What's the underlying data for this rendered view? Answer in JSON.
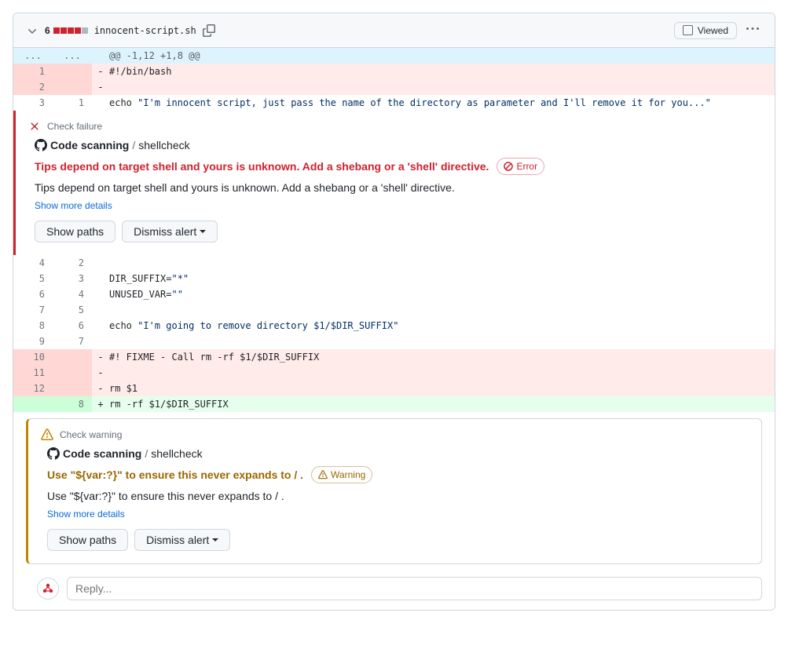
{
  "file_header": {
    "change_count": "6",
    "file_name": "innocent-script.sh",
    "viewed_label": "Viewed"
  },
  "hunk_header": "@@ -1,12 +1,8 @@",
  "lines": [
    {
      "old": "1",
      "new": "",
      "type": "del",
      "marker": "-",
      "code_html": "#!/bin/bash"
    },
    {
      "old": "2",
      "new": "",
      "type": "del",
      "marker": "-",
      "code_html": ""
    },
    {
      "old": "3",
      "new": "1",
      "type": "ctx",
      "marker": "",
      "code_html": "echo <span class=\"str\">\"I'm innocent script, just pass the name of the directory as parameter and I'll remove it for you...\"</span>"
    }
  ],
  "annotation1": {
    "label": "Check failure",
    "source_strong": "Code scanning",
    "source_rest": "shellcheck",
    "title": "Tips depend on target shell and yours is unknown. Add a shebang or a 'shell' directive.",
    "pill": "Error",
    "desc": "Tips depend on target shell and yours is unknown. Add a shebang or a 'shell' directive.",
    "details_link": "Show more details",
    "btn_paths": "Show paths",
    "btn_dismiss": "Dismiss alert"
  },
  "lines2": [
    {
      "old": "4",
      "new": "2",
      "type": "ctx",
      "marker": "",
      "code_html": ""
    },
    {
      "old": "5",
      "new": "3",
      "type": "ctx",
      "marker": "",
      "code_html": "DIR_SUFFIX=<span class=\"str\">\"*\"</span>"
    },
    {
      "old": "6",
      "new": "4",
      "type": "ctx",
      "marker": "",
      "code_html": "UNUSED_VAR=<span class=\"str\">\"\"</span>"
    },
    {
      "old": "7",
      "new": "5",
      "type": "ctx",
      "marker": "",
      "code_html": ""
    },
    {
      "old": "8",
      "new": "6",
      "type": "ctx",
      "marker": "",
      "code_html": "echo <span class=\"str\">\"I'm going to remove directory $1/$DIR_SUFFIX\"</span>"
    },
    {
      "old": "9",
      "new": "7",
      "type": "ctx",
      "marker": "",
      "code_html": ""
    },
    {
      "old": "10",
      "new": "",
      "type": "del",
      "marker": "-",
      "code_html": "#! FIXME - Call rm -rf $1/$DIR_SUFFIX"
    },
    {
      "old": "11",
      "new": "",
      "type": "del",
      "marker": "-",
      "code_html": ""
    },
    {
      "old": "12",
      "new": "",
      "type": "del",
      "marker": "-",
      "code_html": "rm $1"
    },
    {
      "old": "",
      "new": "8",
      "type": "add",
      "marker": "+",
      "code_html": "rm -rf $1/$DIR_SUFFIX"
    }
  ],
  "annotation2": {
    "label": "Check warning",
    "source_strong": "Code scanning",
    "source_rest": "shellcheck",
    "title": "Use \"${var:?}\" to ensure this never expands to / .",
    "pill": "Warning",
    "desc": "Use \"${var:?}\" to ensure this never expands to / .",
    "details_link": "Show more details",
    "btn_paths": "Show paths",
    "btn_dismiss": "Dismiss alert"
  },
  "reply": {
    "placeholder": "Reply..."
  }
}
